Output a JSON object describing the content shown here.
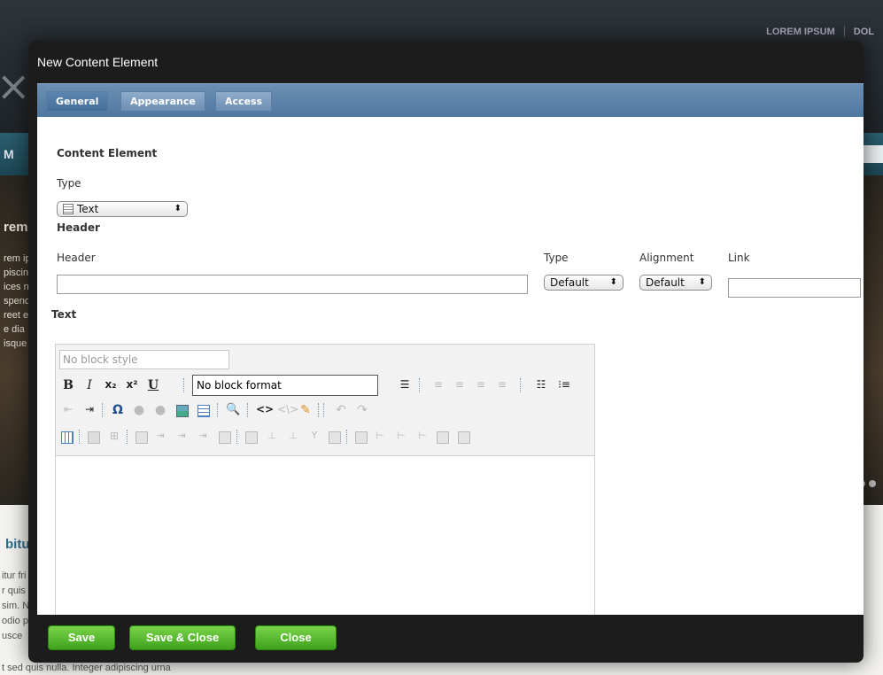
{
  "background": {
    "topnav": [
      "LOREM IPSUM",
      "DOL"
    ],
    "logo": "×",
    "nav_item": "M",
    "hero_title": "rem",
    "hero_lines": [
      "rem ip",
      "piscin",
      "ices n",
      "spend",
      "reet e",
      "e dia",
      "isque"
    ],
    "lower_title": "bitu",
    "lower_lines": [
      "itur fri",
      "r quis",
      "sim. N",
      "odio p",
      "usce"
    ],
    "lower_footer": "t sed quis nulla. Integer adipiscing urna"
  },
  "dialog": {
    "title": "New Content Element",
    "tabs": [
      "General",
      "Appearance",
      "Access"
    ],
    "content_element_heading": "Content Element",
    "type_label": "Type",
    "type_value": "Text",
    "header_heading": "Header",
    "header_label": "Header",
    "header_value": "",
    "header_type_label": "Type",
    "header_type_value": "Default",
    "alignment_label": "Alignment",
    "alignment_value": "Default",
    "link_label": "Link",
    "link_value": "",
    "text_heading": "Text",
    "editor": {
      "block_style_placeholder": "No block style",
      "block_format_value": "No block format",
      "bold": "B",
      "italic": "I",
      "subscript": "x₂",
      "superscript": "x²",
      "underline": "U",
      "omega": "Ω",
      "find": "Find",
      "html": "<>",
      "html2": "<\\>",
      "undo": "↶",
      "redo": "↷"
    },
    "buttons": {
      "save": "Save",
      "save_close": "Save & Close",
      "close": "Close"
    }
  }
}
